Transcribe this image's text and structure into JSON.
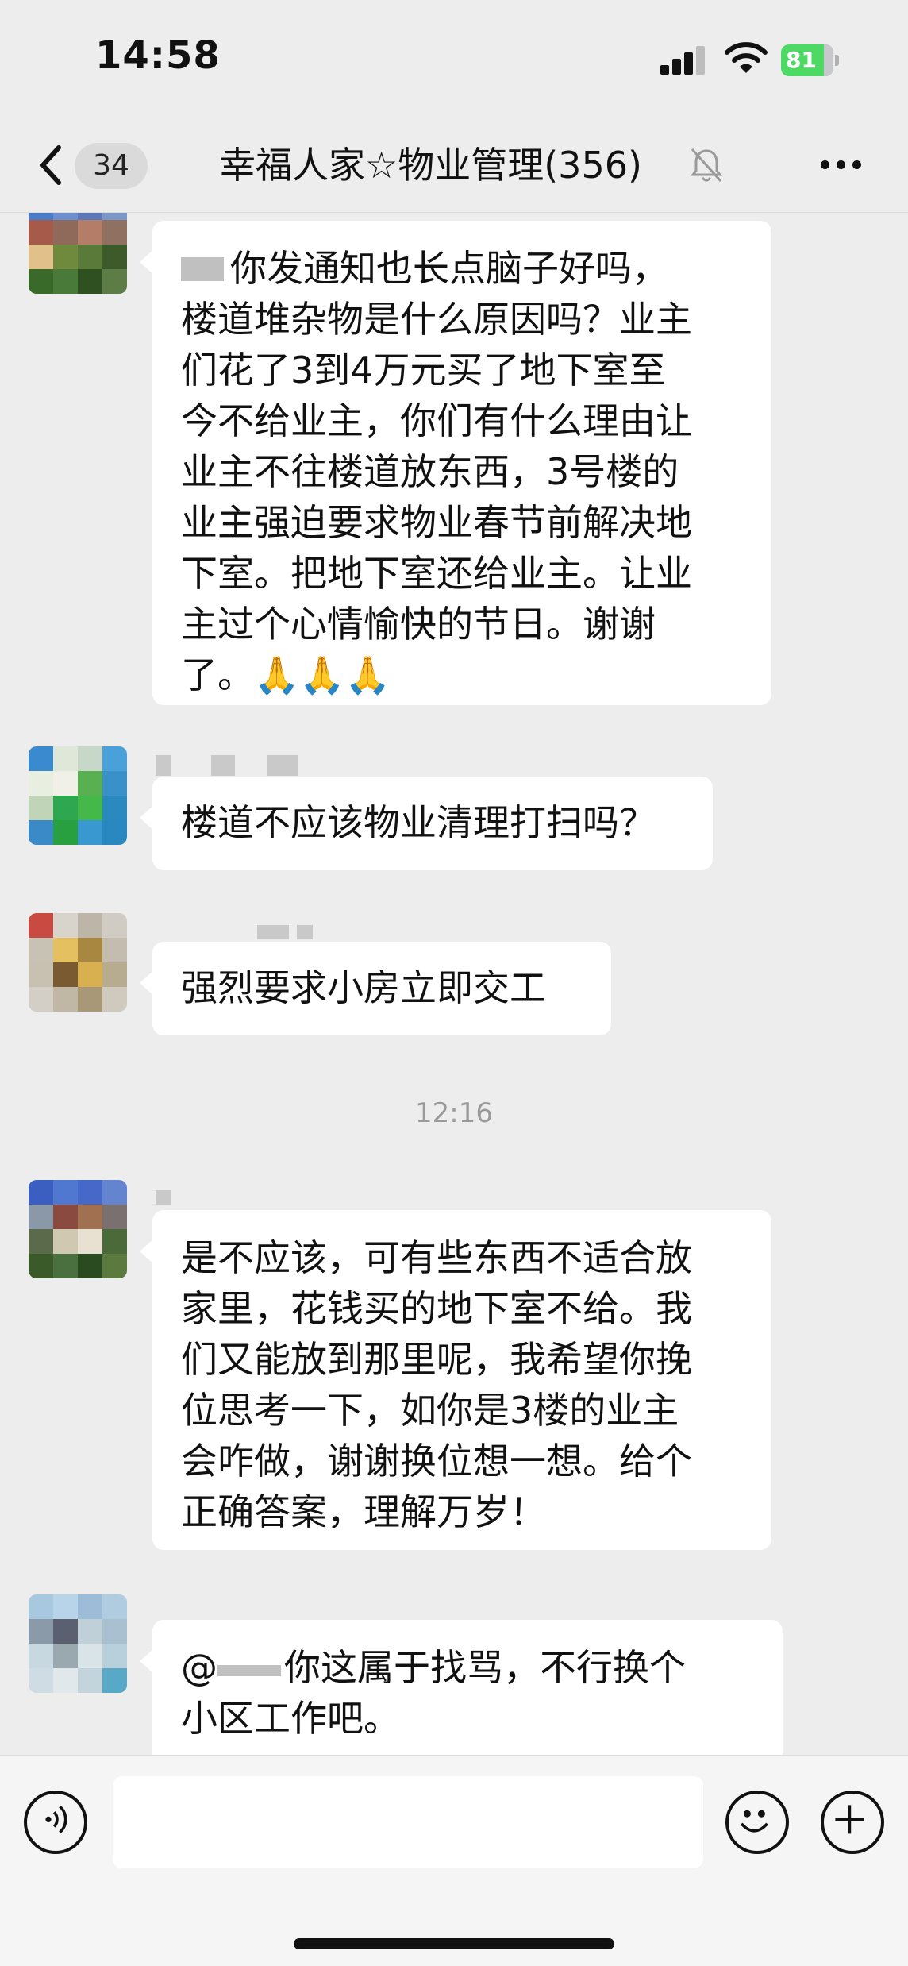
{
  "status_bar": {
    "time": "14:58",
    "battery": "81"
  },
  "header": {
    "unread_count": "34",
    "title": "幸福人家☆物业管理(356)"
  },
  "messages": [
    {
      "text_lines": [
        "你发通知也长点脑子好吗，",
        "楼道堆杂物是什么原因吗？业主",
        "们花了3到4万元买了地下室至",
        "今不给业主，你们有什么理由让",
        "业主不往楼道放东西，3号楼的",
        "业主强迫要求物业春节前解决地",
        "下室。把地下室还给业主。让业",
        "主过个心情愉快的节日。谢谢",
        "了。🙏🙏🙏"
      ]
    },
    {
      "text_lines": [
        "楼道不应该物业清理打扫吗？"
      ]
    },
    {
      "text_lines": [
        "强烈要求小房立即交工"
      ]
    },
    {
      "text_lines": [
        "是不应该，可有些东西不适合放",
        "家里，花钱买的地下室不给。我",
        "们又能放到那里呢，我希望你挽",
        "位思考一下，如你是3楼的业主",
        "会咋做，谢谢换位想一想。给个",
        "正确答案，理解万岁！"
      ]
    },
    {
      "text_lines": [
        "你这属于找骂，不行换个",
        "小区工作吧。"
      ]
    }
  ],
  "timestamp": "12:16",
  "mention_prefix": "@",
  "colors": {
    "background": "#ededed",
    "bubble": "#ffffff",
    "battery_green": "#4cd964"
  }
}
